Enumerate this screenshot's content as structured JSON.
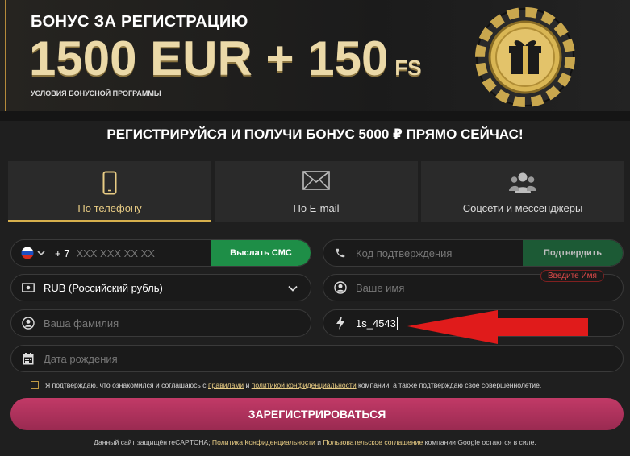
{
  "banner": {
    "title": "БОНУС ЗА РЕГИСТРАЦИЮ",
    "amount": "1500 EUR + 150",
    "amount_suffix": "FS",
    "terms_link": "УСЛОВИЯ БОНУСНОЙ ПРОГРАММЫ"
  },
  "headline": "РЕГИСТРИРУЙСЯ И ПОЛУЧИ БОНУС 5000 ₽ ПРЯМО СЕЙЧАС!",
  "tabs": [
    {
      "label": "По телефону",
      "icon": "phone-icon",
      "active": true
    },
    {
      "label": "По E-mail",
      "icon": "envelope-icon",
      "active": false
    },
    {
      "label": "Соцсети и мессенджеры",
      "icon": "users-icon",
      "active": false
    }
  ],
  "form": {
    "phone_prefix": "+ 7",
    "phone_placeholder": "XXX XXX XX XX",
    "send_sms": "Выслать СМС",
    "code_placeholder": "Код подтверждения",
    "confirm": "Подтвердить",
    "name_error": "Введите Имя",
    "currency_value": "RUB (Российский рубль)",
    "name_placeholder": "Ваше имя",
    "surname_placeholder": "Ваша фамилия",
    "promo_value": "1s_4543",
    "birthdate_placeholder": "Дата рождения"
  },
  "agree": {
    "prefix": "Я подтверждаю, что ознакомился и соглашаюсь с",
    "rules_link": "правилами",
    "and": "и",
    "privacy_link": "политикой конфиденциальности",
    "suffix": "компании, а также подтверждаю свое совершеннолетие."
  },
  "register_button": "ЗАРЕГИСТРИРОВАТЬСЯ",
  "recaptcha": {
    "prefix": "Данный сайт защищён reCAPTCHA;",
    "privacy_link": "Политика Конфиденциальности",
    "and": "и",
    "terms_link": "Пользовательское соглашение",
    "suffix": "компании Google остаются в силе."
  },
  "colors": {
    "accent_gold": "#d7b04d",
    "green": "#1e8e47",
    "register": "#b23560",
    "arrow": "#e01b1b"
  }
}
